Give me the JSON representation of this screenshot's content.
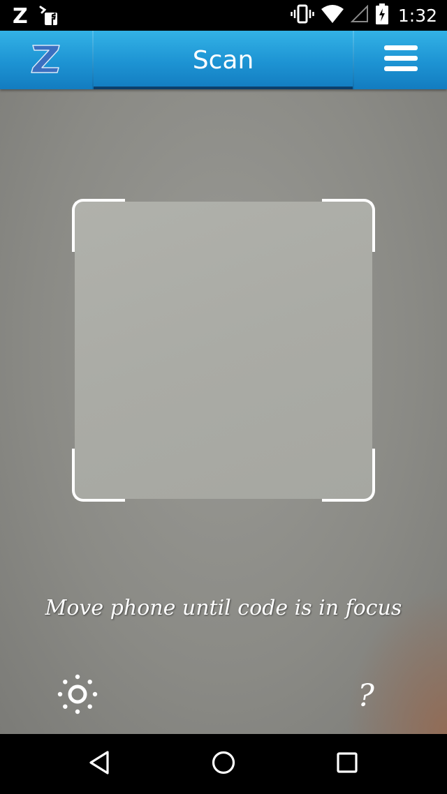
{
  "status_bar": {
    "time": "1:32",
    "left_icons": [
      "z-notification-icon",
      "facebook-notification-icon"
    ],
    "right_icons": [
      "vibrate-icon",
      "wifi-icon",
      "signal-icon",
      "battery-charging-icon"
    ]
  },
  "header": {
    "logo_icon": "z-logo-icon",
    "title": "Scan",
    "menu_icon": "hamburger-menu-icon",
    "accent_color": "#1d93d3"
  },
  "scanner": {
    "hint": "Move phone until code is in focus",
    "light_icon": "light-icon",
    "help_label": "?"
  },
  "nav_bar": {
    "icons": [
      "back-icon",
      "home-icon",
      "recents-icon"
    ]
  }
}
